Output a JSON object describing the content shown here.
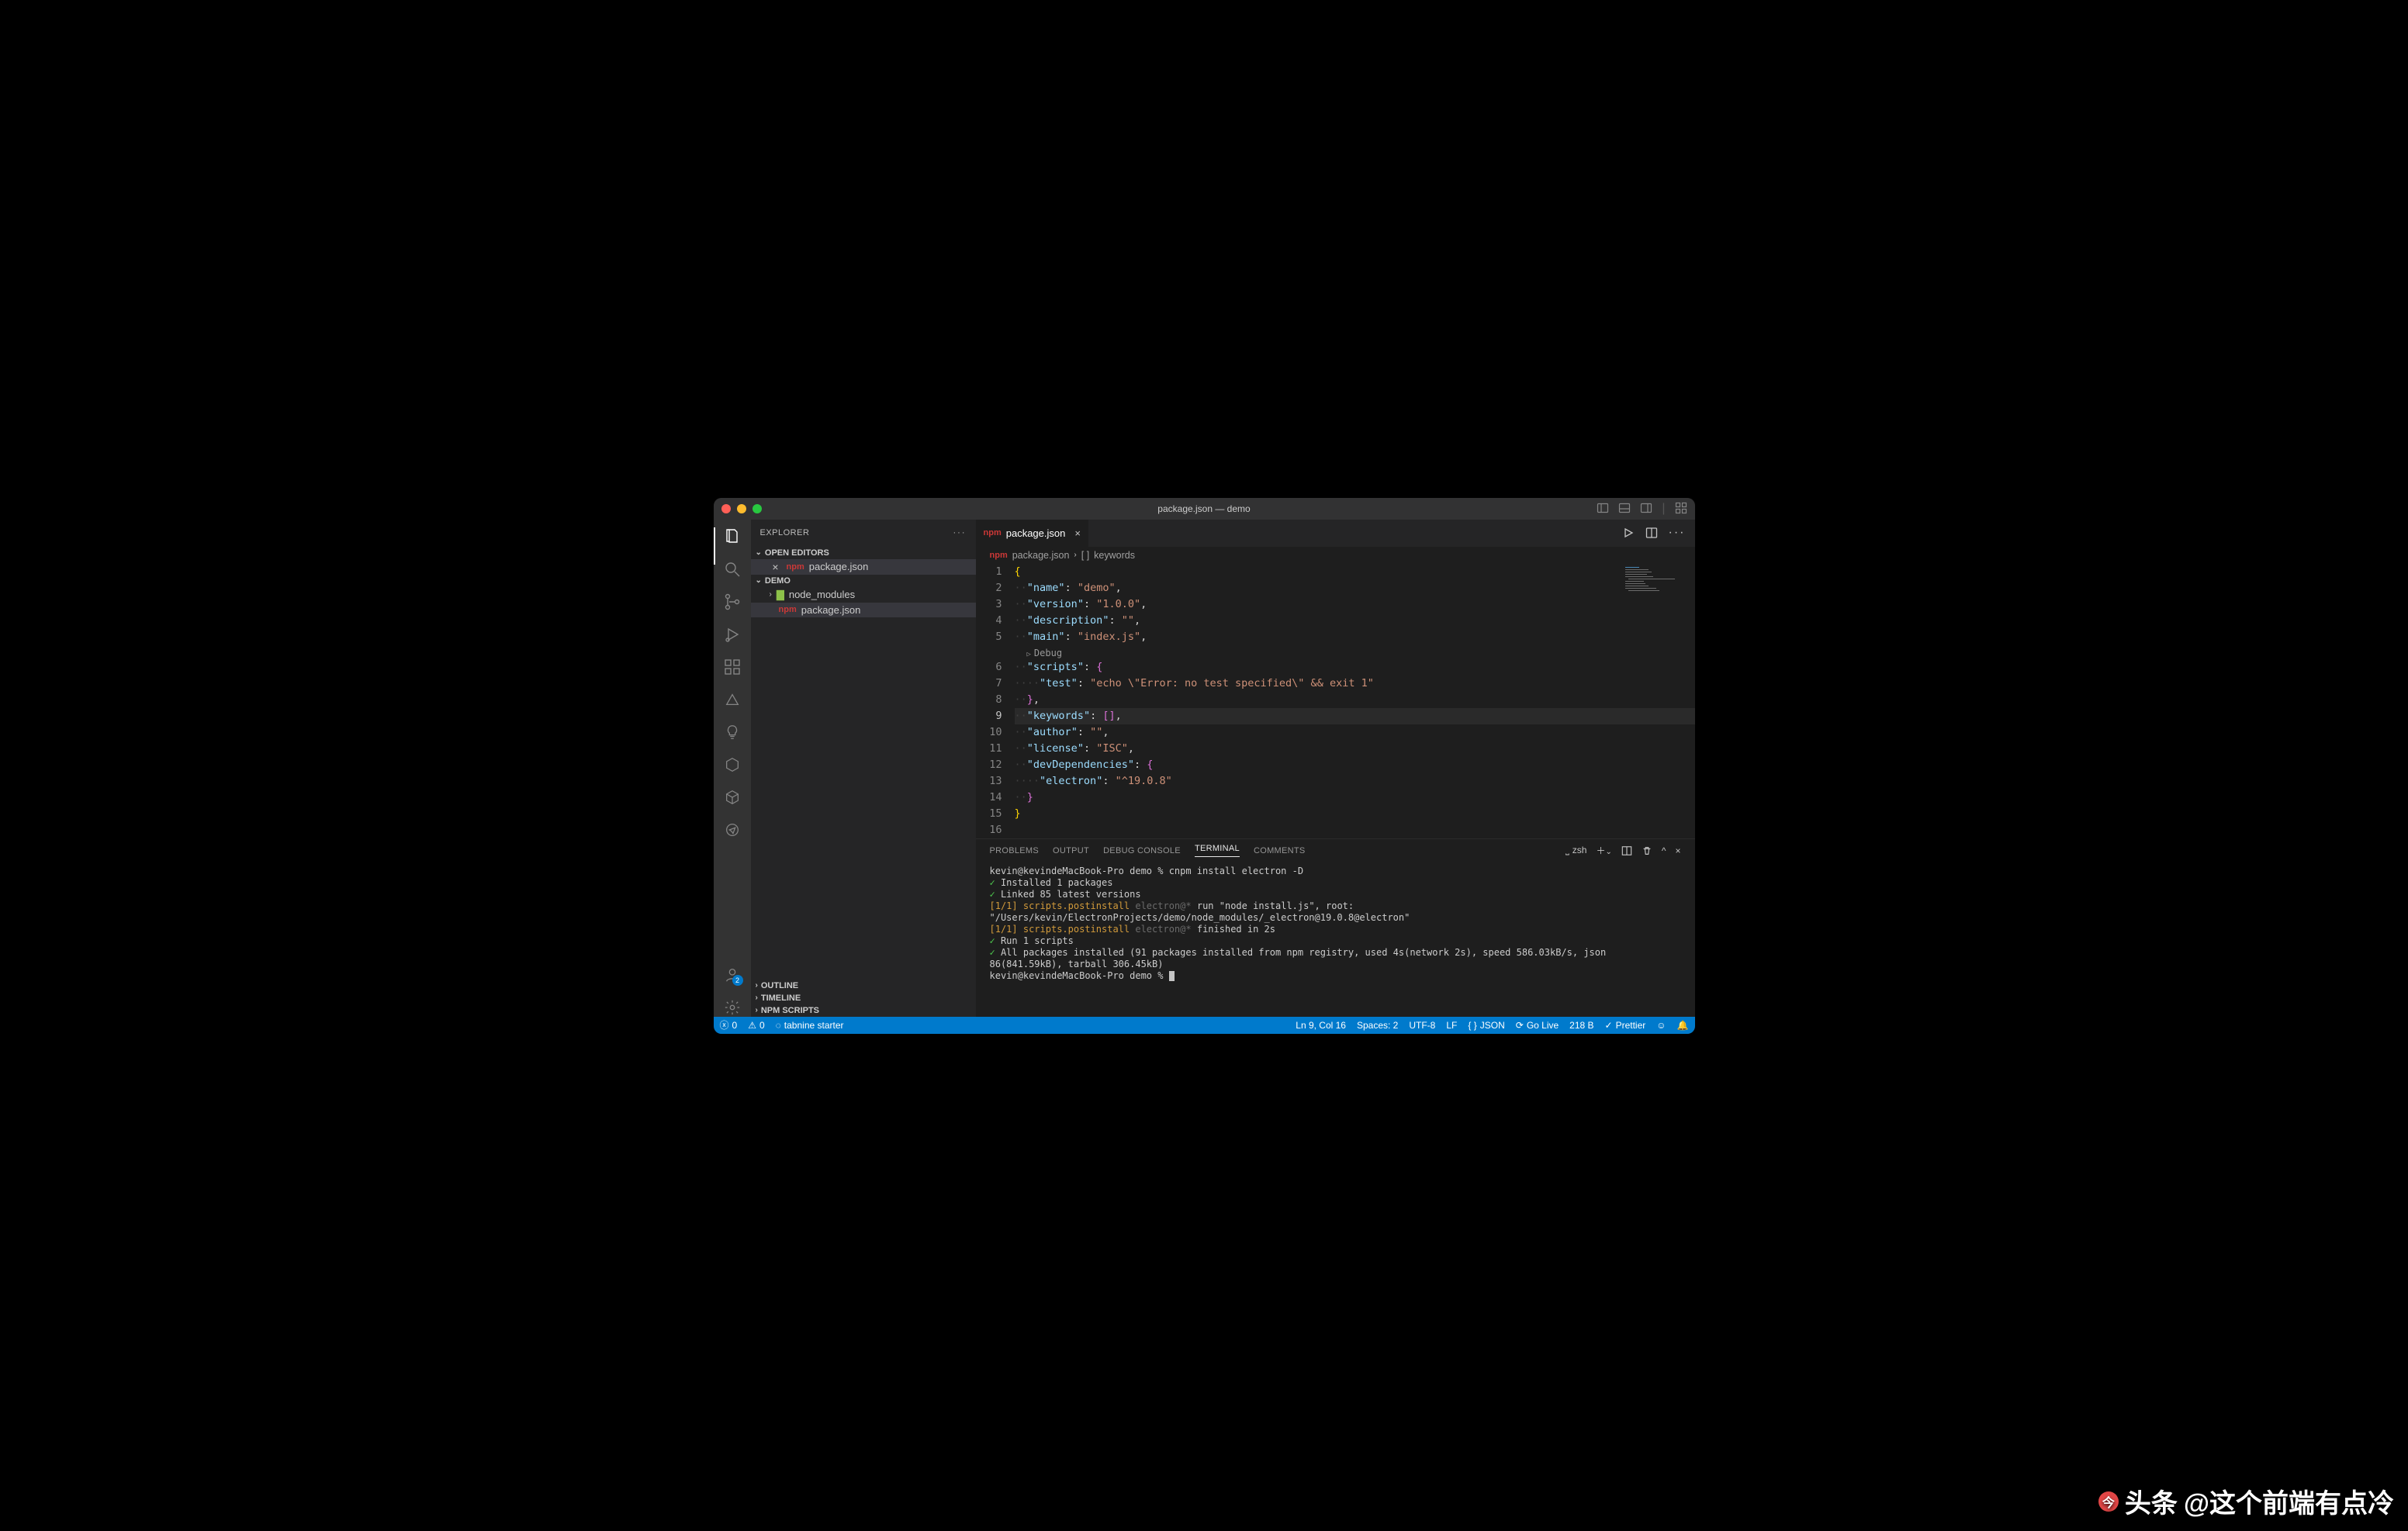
{
  "window": {
    "title": "package.json — demo"
  },
  "sidebar": {
    "title": "EXPLORER",
    "openEditorsLabel": "OPEN EDITORS",
    "openEditors": [
      {
        "label": "package.json"
      }
    ],
    "projectLabel": "DEMO",
    "tree": {
      "nodeModules": "node_modules",
      "packageJson": "package.json"
    },
    "outline": "OUTLINE",
    "timeline": "TIMELINE",
    "npmScripts": "NPM SCRIPTS"
  },
  "tab": {
    "label": "package.json"
  },
  "breadcrumb": {
    "file": "package.json",
    "sym": "keywords"
  },
  "codelens": {
    "debug": "Debug"
  },
  "code": {
    "lines": [
      1,
      2,
      3,
      4,
      5,
      6,
      7,
      8,
      9,
      10,
      11,
      12,
      13,
      14,
      15,
      16
    ],
    "activeLine": 9,
    "kv": {
      "name": "name",
      "name_v": "demo",
      "version": "version",
      "version_v": "1.0.0",
      "description": "description",
      "description_v": "",
      "main": "main",
      "main_v": "index.js",
      "scripts": "scripts",
      "test": "test",
      "test_v": "echo \\\"Error: no test specified\\\" && exit 1",
      "keywords": "keywords",
      "author": "author",
      "author_v": "",
      "license": "license",
      "license_v": "ISC",
      "devDependencies": "devDependencies",
      "electron": "electron",
      "electron_v": "^19.0.8"
    }
  },
  "panel": {
    "tabs": {
      "problems": "PROBLEMS",
      "output": "OUTPUT",
      "debug": "DEBUG CONSOLE",
      "terminal": "TERMINAL",
      "comments": "COMMENTS"
    },
    "shell": "zsh"
  },
  "terminal": {
    "l1": "kevin@kevindeMacBook-Pro demo % cnpm install electron -D",
    "l2": "Installed 1 packages",
    "l3": "Linked 85 latest versions",
    "l4a": "[1/1] scripts.postinstall",
    "l4b": "electron@*",
    "l4c": "run \"node install.js\", root: \"/Users/kevin/ElectronProjects/demo/node_modules/_electron@19.0.8@electron\"",
    "l5a": "[1/1] scripts.postinstall",
    "l5b": "electron@*",
    "l5c": "finished in 2s",
    "l6": "Run 1 scripts",
    "l7": "All packages installed (91 packages installed from npm registry, used 4s(network 2s), speed 586.03kB/s, json 86(841.59kB), tarball 306.45kB)",
    "l8": "kevin@kevindeMacBook-Pro demo % "
  },
  "status": {
    "errors": "0",
    "warnings": "0",
    "tabnine": "tabnine starter",
    "cursor": "Ln 9, Col 16",
    "spaces": "Spaces: 2",
    "enc": "UTF-8",
    "eol": "LF",
    "lang": "JSON",
    "golive": "Go Live",
    "size": "218 B",
    "prettier": "Prettier"
  },
  "watermark": {
    "text": "@这个前端有点冷",
    "brand": "头条"
  },
  "accountBadge": "2"
}
